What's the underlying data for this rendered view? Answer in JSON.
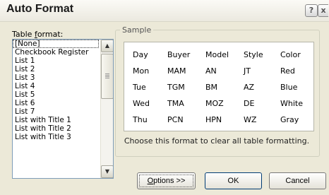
{
  "window": {
    "title": "Auto Format",
    "help_symbol": "?",
    "close_symbol": "x"
  },
  "table_format": {
    "label_underlined_char": "f",
    "label_prefix": "Table ",
    "label_suffix": "ormat:",
    "selected": "[None]",
    "items": [
      "[None]",
      "Checkbook Register",
      "List 1",
      "List 2",
      "List 3",
      "List 4",
      "List 5",
      "List 6",
      "List 7",
      "List with Title 1",
      "List with Title 2",
      "List with Title 3"
    ]
  },
  "sample": {
    "label": "Sample",
    "rows": [
      [
        "Day",
        "Buyer",
        "Model",
        "Style",
        "Color"
      ],
      [
        "Mon",
        "MAM",
        "AN",
        "JT",
        "Red"
      ],
      [
        "Tue",
        "TGM",
        "BM",
        "AZ",
        "Blue"
      ],
      [
        "Wed",
        "TMA",
        "MOZ",
        "DE",
        "White"
      ],
      [
        "Thu",
        "PCN",
        "HPN",
        "WZ",
        "Gray"
      ]
    ],
    "description": "Choose this format to clear all table formatting."
  },
  "buttons": {
    "options_underlined": "O",
    "options_rest": "ptions >>",
    "ok": "OK",
    "cancel": "Cancel"
  },
  "scrollbar": {
    "up_symbol": "▲",
    "down_symbol": "▼"
  }
}
